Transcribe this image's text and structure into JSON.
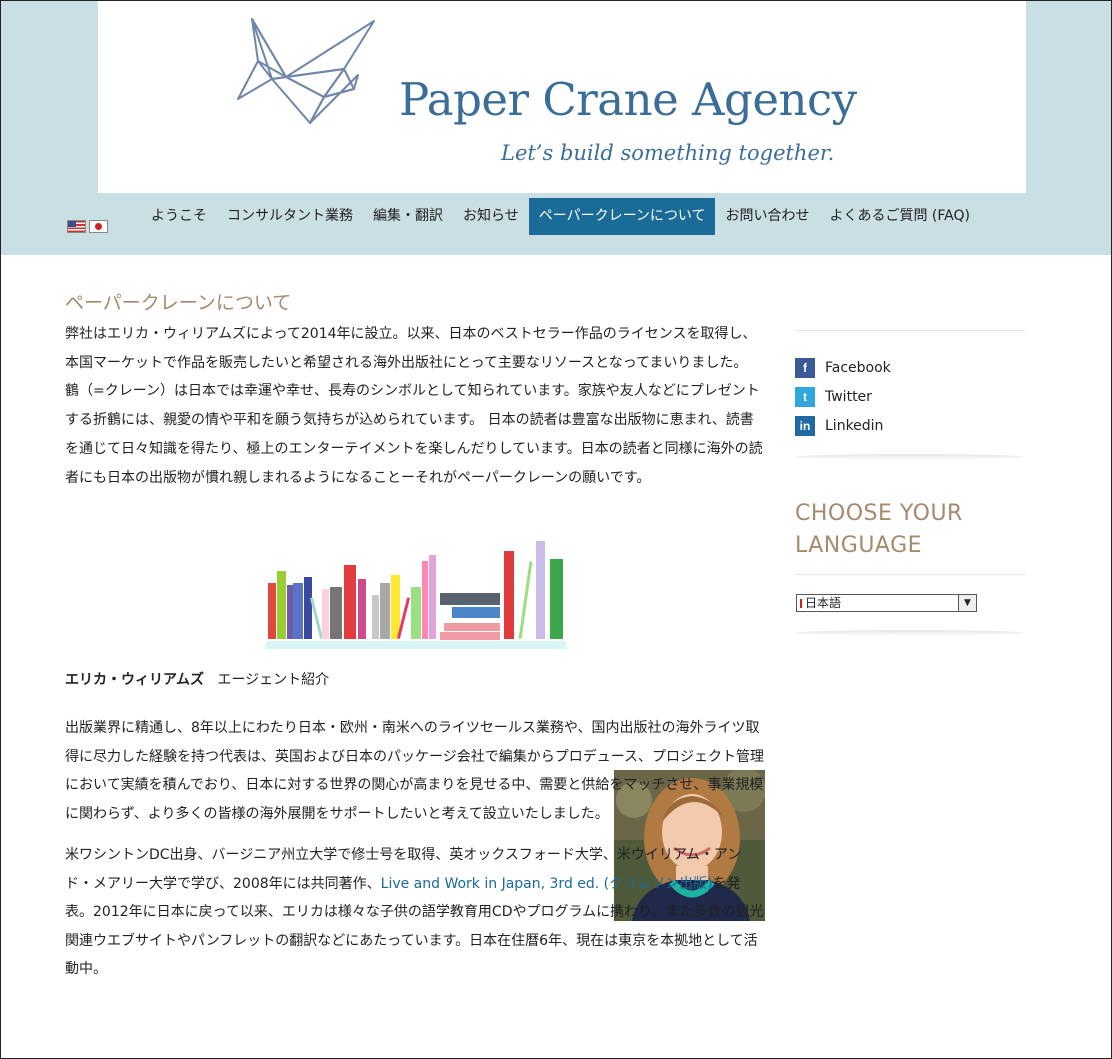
{
  "header": {
    "brand": "Paper Crane Agency",
    "tagline": "Let’s build something together."
  },
  "flags": [
    "us-flag-icon",
    "japan-flag-icon"
  ],
  "nav": {
    "items": [
      {
        "label": "ようこそ"
      },
      {
        "label": "コンサルタント業務"
      },
      {
        "label": "編集・翻訳"
      },
      {
        "label": "お知らせ"
      },
      {
        "label": "ペーパークレーンについて",
        "active": true
      },
      {
        "label": "お問い合わせ"
      },
      {
        "label": "よくあるご質問 (FAQ)"
      }
    ]
  },
  "main": {
    "title": "ペーパークレーンについて",
    "intro": "弊社はエリカ・ウィリアムズによって2014年に設立。以来、日本のベストセラー作品のライセンスを取得し、本国マーケットで作品を販売したいと希望される海外出版社にとって主要なリソースとなってまいりました。 鶴（=クレーン）は日本では幸運や幸せ、長寿のシンボルとして知られています。家族や友人などにプレゼントする折鶴には、親愛の情や平和を願う気持ちが込められています。 日本の読者は豊富な出版物に恵まれ、読書を通じて日々知識を得たり、極上のエンターテイメントを楽しんだりしています。日本の読者と同様に海外の読者にも日本の出版物が慣れ親しまれるようになることーそれがペーパークレーンの願いです。",
    "agent_name": "エリカ・ウィリアムズ",
    "agent_label": "エージェント紹介",
    "bio1": "出版業界に精通し、8年以上にわたり日本・欧州・南米へのライツセールス業務や、国内出版社の海外ライツ取得に尽力した経験を持つ代表は、英国および日本のパッケージ会社で編集からプロデュース、プロジェクト管理において実績を積んでおり、日本に対する世界の関心が高まりを見せる中、需要と供給をマッチさせ、事業規模に関わらず、より多くの皆様の海外展開をサポートしたいと考えて設立いたしました。",
    "bio2_before": "米ワシントンDC出身、バージニア州立大学で修士号を取得、英オックスフォード大学、米ウイリアム・アンド・メアリー大学で学び、2008年には共同著作、",
    "bio2_link": "Live and Work in Japan, 3rd ed. (クリムソン出版)",
    "bio2_after": "を発表。2012年に日本に戻って以来、エリカは様々な子供の語学教育用CDやプログラムに携わり、また多数の観光関連ウエブサイトやパンフレットの翻訳などにあたっています。日本在住暦6年、現在は東京を本拠地として活動中。"
  },
  "sidebar": {
    "social": [
      {
        "label": "Facebook",
        "icon": "facebook-icon"
      },
      {
        "label": "Twitter",
        "icon": "twitter-icon"
      },
      {
        "label": "Linkedin",
        "icon": "linkedin-icon"
      }
    ],
    "language_heading": "CHOOSE YOUR LANGUAGE",
    "language_selected": "日本語"
  },
  "colors": {
    "nav_active": "#1a6b98",
    "brand": "#3a6d97",
    "heading": "#a58a6c",
    "top_band": "#c9dfe4"
  }
}
